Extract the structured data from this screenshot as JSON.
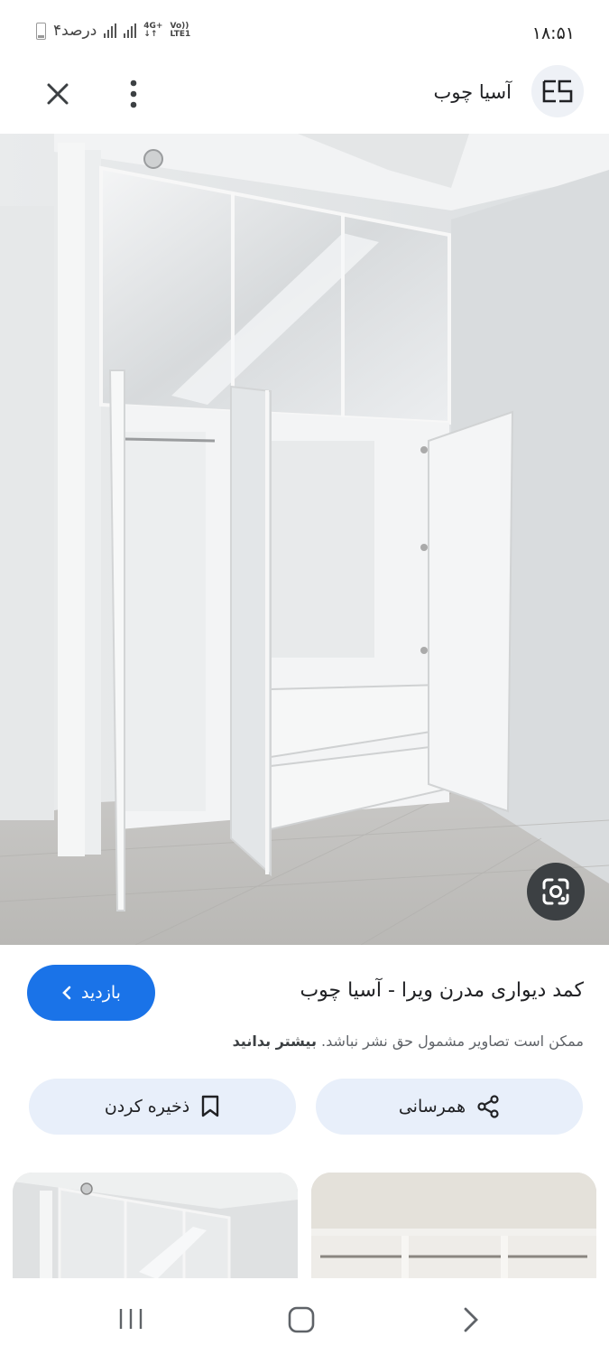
{
  "status_bar": {
    "time": "۱۸:۵۱",
    "battery": "۴درصد",
    "network_top": "4G+",
    "network_bottom": "↓↑",
    "volte_top": "Vo))",
    "volte_bottom": "LTE1"
  },
  "app_bar": {
    "site_name": "آسیا چوب",
    "logo_text": "ES",
    "close_icon": "close-icon",
    "more_icon": "more-vert-icon"
  },
  "hero": {
    "lens_icon": "google-lens-icon"
  },
  "info": {
    "visit_label": "بازدید",
    "title": "کمد دیواری مدرن ویرا - آسیا چوب",
    "copyright_text": "ممکن است تصاویر مشمول حق نشر نباشد.",
    "learn_more": "بیشتر بدانید"
  },
  "actions": {
    "share_label": "همرسانی",
    "save_label": "ذخیره کردن"
  },
  "colors": {
    "accent": "#1a73e8",
    "tonal": "#e8effa"
  }
}
